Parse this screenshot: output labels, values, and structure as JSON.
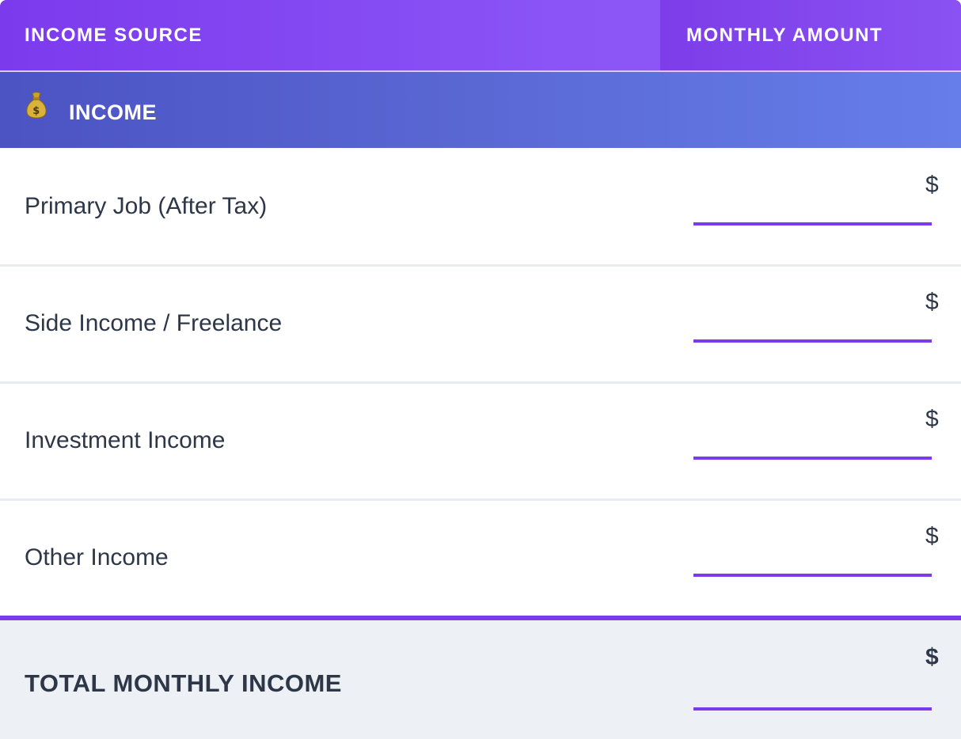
{
  "header": {
    "source_label": "INCOME SOURCE",
    "amount_label": "MONTHLY AMOUNT"
  },
  "section": {
    "icon": "money-bag-icon",
    "label": "INCOME"
  },
  "rows": [
    {
      "label": "Primary Job (After Tax)",
      "currency": "$",
      "value": ""
    },
    {
      "label": "Side Income / Freelance",
      "currency": "$",
      "value": ""
    },
    {
      "label": "Investment Income",
      "currency": "$",
      "value": ""
    },
    {
      "label": "Other Income",
      "currency": "$",
      "value": ""
    }
  ],
  "total": {
    "label": "TOTAL MONTHLY INCOME",
    "currency": "$",
    "value": ""
  },
  "colors": {
    "accent": "#7c3aed",
    "section_gradient_start": "#4c53c3",
    "section_gradient_end": "#667eea",
    "total_background": "#edf1f6"
  }
}
